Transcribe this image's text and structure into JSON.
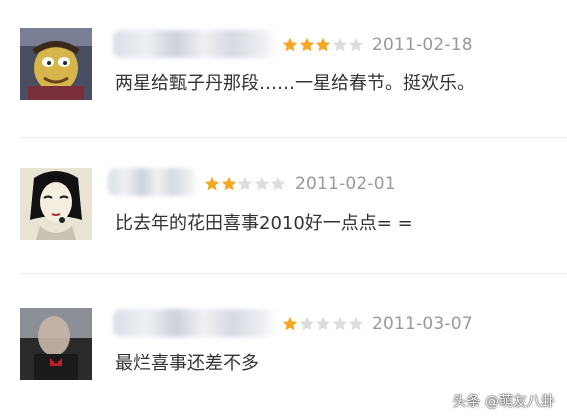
{
  "reviews": [
    {
      "rating": 3,
      "date": "2011-02-18",
      "comment": "两星给甄子丹那段……一星给春节。挺欢乐。"
    },
    {
      "rating": 2,
      "date": "2011-02-01",
      "comment": "比去年的花田喜事2010好一点点= ="
    },
    {
      "rating": 1,
      "date": "2011-03-07",
      "comment": "最烂喜事还差不多"
    }
  ],
  "watermark": "头条 @萌友八卦",
  "colors": {
    "star_filled": "#f5a623",
    "star_empty": "#dddddd",
    "date": "#999999",
    "comment": "#333333",
    "divider": "#ececec"
  }
}
